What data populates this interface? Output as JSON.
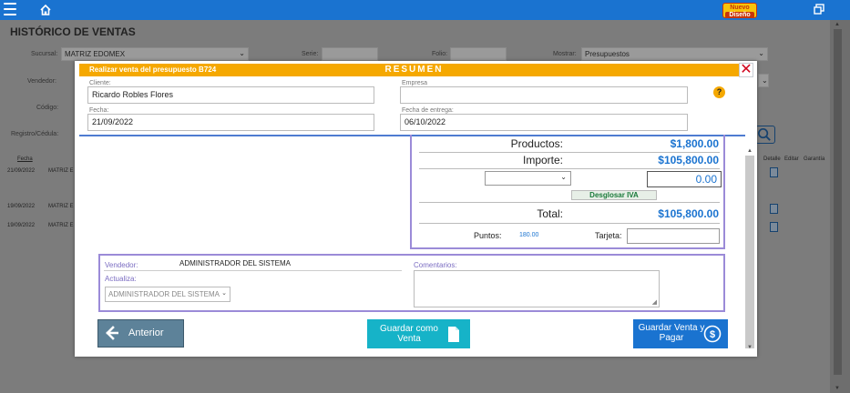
{
  "topbar": {
    "logo_line1": "Nuevo",
    "logo_line2": "Diseño"
  },
  "background": {
    "title": "HISTÓRICO DE VENTAS",
    "labels": {
      "sucursal": "Sucursal:",
      "serie": "Serie:",
      "folio": "Folio:",
      "mostrar": "Mostrar:",
      "vendedor": "Vendedor:",
      "codigo": "Código:",
      "registro": "Registro/Cédula:"
    },
    "sucursal_value": "MATRIZ EDOMEX",
    "mostrar_value": "Presupuestos",
    "table": {
      "headers": [
        "Fecha",
        "Detalle",
        "Editar",
        "Garantía"
      ],
      "rows": [
        {
          "fecha": "21/09/2022",
          "sucursal": "MATRIZ E"
        },
        {
          "fecha": "19/09/2022",
          "sucursal": "MATRIZ E"
        },
        {
          "fecha": "19/09/2022",
          "sucursal": "MATRIZ E"
        }
      ]
    }
  },
  "modal": {
    "subtitle": "Realizar venta del presupuesto B724",
    "title": "RESUMEN",
    "close": "✕",
    "cliente_label": "Cliente:",
    "cliente_value": "Ricardo Robles Flores",
    "empresa_label": "Empresa",
    "empresa_value": "",
    "fecha_label": "Fecha:",
    "fecha_value": "21/09/2022",
    "entrega_label": "Fecha de entrega:",
    "entrega_value": "06/10/2022",
    "help": "?",
    "totals": {
      "productos_label": "Productos:",
      "productos_value": "$1,800.00",
      "importe_label": "Importe:",
      "importe_value": "$105,800.00",
      "descuento_value": "0.00",
      "desglosar_label": "Desglosar IVA",
      "total_label": "Total:",
      "total_value": "$105,800.00",
      "puntos_label": "Puntos:",
      "puntos_value": "180.00",
      "tarjeta_label": "Tarjeta:"
    },
    "vendedor_label": "Vendedor:",
    "vendedor_value": "ADMINISTRADOR DEL SISTEMA",
    "actualiza_label": "Actualiza:",
    "actualiza_value": "ADMINISTRADOR DEL SISTEMA",
    "comentarios_label": "Comentarios:",
    "buttons": {
      "anterior": "Anterior",
      "guardar_venta": "Guardar como Venta",
      "guardar_pagar": "Guardar Venta y Pagar"
    }
  },
  "colors": {
    "topbar": "#1a73d0",
    "header": "#f5a800",
    "accent": "#1a73d0",
    "border": "#9b8bd8",
    "teal": "#16b3c8"
  }
}
